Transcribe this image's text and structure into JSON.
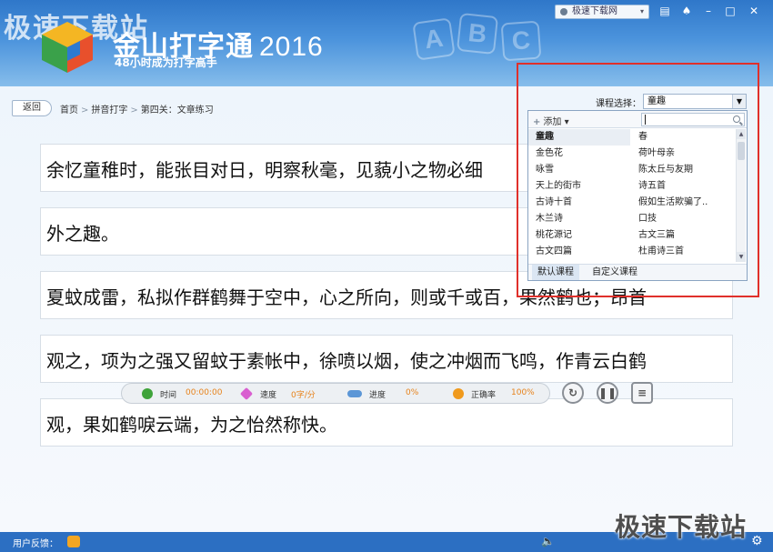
{
  "header": {
    "watermark": "极速下载站",
    "app_name": "金山打字通",
    "year": "2016",
    "tagline": "48小时成为打字高手",
    "abc_letters": [
      "A",
      "B",
      "C"
    ],
    "account_label": "极速下载网",
    "window_buttons": [
      "skin-icon",
      "shirt-icon",
      "minimize-icon",
      "maximize-icon",
      "close-icon"
    ]
  },
  "nav": {
    "back_label": "返回",
    "breadcrumb": [
      "首页",
      "拼音打字",
      "第四关：文章练习"
    ],
    "separator": ">"
  },
  "lines": [
    "余忆童稚时，能张目对日，明察秋毫，见藐小之物必细",
    "外之趣。",
    "夏蚊成雷，私拟作群鹤舞于空中，心之所向，则或千或百，果然鹤也；昂首",
    "观之，项为之强又留蚊于素帐中，徐喷以烟，使之冲烟而飞鸣，作青云白鹤",
    "观，果如鹤唳云端，为之怡然称快。"
  ],
  "course": {
    "label": "课程选择：",
    "selected": "童趣",
    "add_label": "添加",
    "search_value": "",
    "items_left": [
      "童趣",
      "金色花",
      "咏雪",
      "天上的街市",
      "古诗十首",
      "木兰诗",
      "桃花源记",
      "古文四篇"
    ],
    "items_right": [
      "春",
      "荷叶母亲",
      "陈太丘与友期",
      "诗五首",
      "假如生活欺骗了..",
      "口技",
      "古文三篇",
      "杜甫诗三首"
    ],
    "tabs": [
      "默认课程",
      "自定义课程"
    ]
  },
  "stats": {
    "time_label": "时间",
    "time_value": "00:00:00",
    "speed_label": "速度",
    "speed_value": "0字/分",
    "progress_label": "进度",
    "progress_value": "0%",
    "accuracy_label": "正确率",
    "accuracy_value": "100%"
  },
  "bottom": {
    "feedback_label": "用户反馈："
  },
  "footer_watermark": "极速下载站",
  "colors": {
    "header_blue": "#2f77c9",
    "accent_orange": "#e7821a",
    "highlight_red": "#e0302b"
  }
}
